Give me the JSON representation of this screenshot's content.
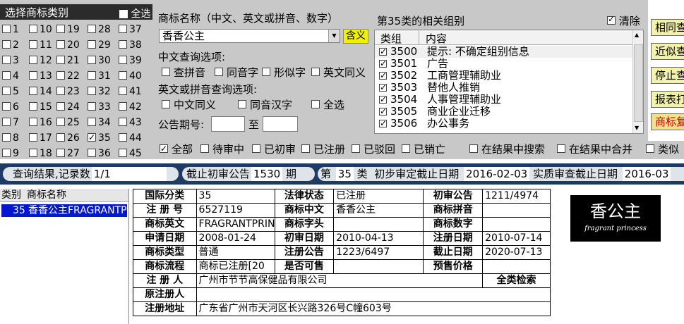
{
  "category_panel": {
    "title": "选择商标类别",
    "select_all_label": "全选",
    "columns": [
      [
        "1",
        "2",
        "3",
        "4",
        "5",
        "6",
        "7",
        "8",
        "9"
      ],
      [
        "10",
        "11",
        "12",
        "13",
        "14",
        "15",
        "16",
        "17",
        "18"
      ],
      [
        "19",
        "20",
        "21",
        "22",
        "23",
        "24",
        "25",
        "26",
        "27"
      ],
      [
        "28",
        "29",
        "30",
        "31",
        "32",
        "33",
        "34",
        "35",
        "36"
      ],
      [
        "37",
        "38",
        "39",
        "40",
        "41",
        "42",
        "43",
        "44",
        "45"
      ]
    ],
    "checked": [
      "35"
    ]
  },
  "search": {
    "name_label": "商标名称（中文、英文或拼音、数字）",
    "name_value": "香香公主",
    "meaning_button": "含义",
    "cn_options_label": "中文查询选项:",
    "cn_options": [
      "查拼音",
      "同音字",
      "形似字",
      "英文同义"
    ],
    "en_options_label": "英文或拼音查询选项:",
    "en_options": [
      "中文同义",
      "同音汉字",
      "全选"
    ],
    "period_label": "公告期号:",
    "period_to": "至"
  },
  "groups": {
    "title": "第35类的相关组别",
    "clear_label": "清除",
    "header_code": "类组",
    "header_desc": "内容",
    "rows": [
      {
        "code": "3500",
        "desc": "提示: 不确定组别信息"
      },
      {
        "code": "3501",
        "desc": "广告"
      },
      {
        "code": "3502",
        "desc": "工商管理辅助业"
      },
      {
        "code": "3503",
        "desc": "替他人推销"
      },
      {
        "code": "3504",
        "desc": "人事管理辅助业"
      },
      {
        "code": "3505",
        "desc": "商业企业迁移"
      },
      {
        "code": "3506",
        "desc": "办公事务"
      }
    ]
  },
  "right_buttons": [
    "相同查",
    "近似查",
    "停止查",
    "报表打",
    "商标复"
  ],
  "filters": {
    "statuses": [
      "全部",
      "待审中",
      "已初审",
      "已注册",
      "已驳回",
      "已销亡"
    ],
    "search_in_results": "在结果中搜索",
    "merge_in_results": "在结果中合并",
    "similar": "类似"
  },
  "status_bar": {
    "result_label": "查询结果,记录数",
    "result_value": "1/1",
    "deadline_label": "截止初审公告",
    "deadline_value": "1530",
    "deadline_unit": "期",
    "class_prefix": "第",
    "class_value": "35",
    "class_suffix": "类",
    "prelim_label": "初步审定截止日期",
    "prelim_value": "2016-02-03",
    "subst_label": "实质审查截止日期",
    "subst_value": "2016-03"
  },
  "results": {
    "header_class": "类别",
    "header_name": "商标名称",
    "row_class": "35",
    "row_name": "香香公主FRAGRANTPI"
  },
  "detail": {
    "intl_class_k": "国际分类",
    "intl_class_v": "35",
    "legal_status_k": "法律状态",
    "legal_status_v": "已注册",
    "prelim_pub_k": "初审公告",
    "prelim_pub_v": "1211/4974",
    "reg_no_k": "注 册 号",
    "reg_no_v": "6527119",
    "mark_cn_k": "商标中文",
    "mark_cn_v": "香香公主",
    "mark_pinyin_k": "商标拼音",
    "mark_pinyin_v": "",
    "mark_en_k": "商标英文",
    "mark_en_v": "FRAGRANTPRINC",
    "mark_initial_k": "商标字头",
    "mark_initial_v": "",
    "mark_digits_k": "商标数字",
    "mark_digits_v": "",
    "apply_date_k": "申请日期",
    "apply_date_v": "2008-01-24",
    "prelim_date_k": "初审日期",
    "prelim_date_v": "2010-04-13",
    "reg_date_k": "注册日期",
    "reg_date_v": "2010-07-14",
    "mark_type_k": "商标类型",
    "mark_type_v": "普通",
    "reg_pub_k": "注册公告",
    "reg_pub_v": "1223/6497",
    "expire_k": "截止日期",
    "expire_v": "2020-07-13",
    "flow_k": "商标流程",
    "flow_v": "商标已注册[20",
    "for_sale_k": "是否可售",
    "for_sale_v": "",
    "presale_price_k": "预售价格",
    "presale_price_v": "",
    "registrant_k": "注 册 人",
    "registrant_v": "广州市节节高保健品有限公司",
    "all_class_search": "全类检索",
    "orig_registrant_k": "原注册人",
    "orig_registrant_v": "",
    "address_k": "注册地址",
    "address_v": "广东省广州市天河区长兴路326号C幢603号"
  },
  "logo": {
    "cn": "香公主",
    "en": "fragrant princess"
  }
}
